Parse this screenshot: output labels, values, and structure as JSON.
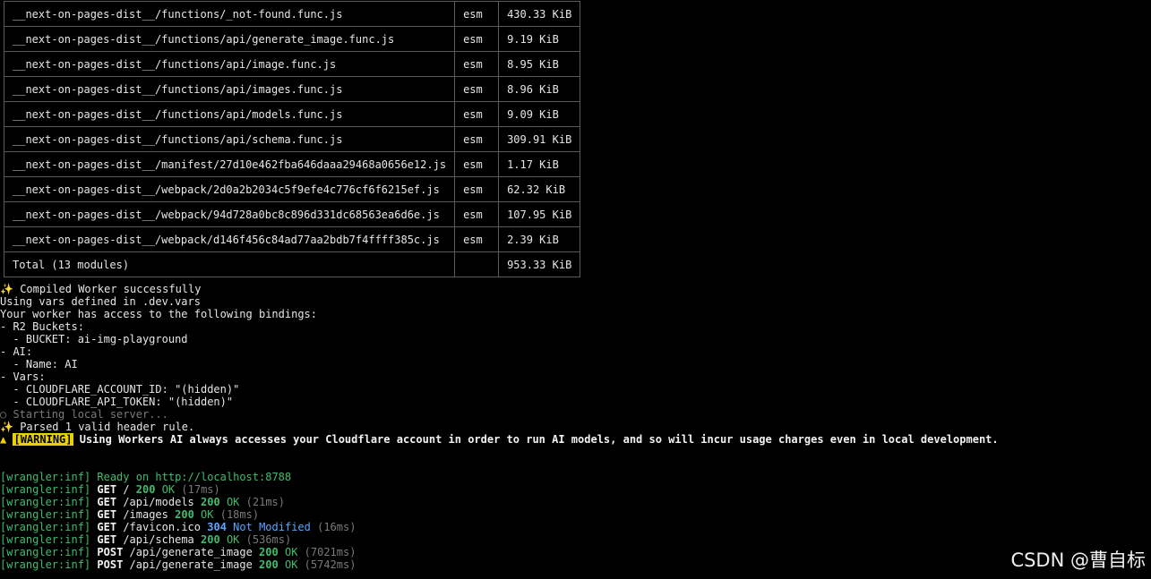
{
  "modules": [
    {
      "name": "__next-on-pages-dist__/functions/_not-found.func.js",
      "format": "esm",
      "size": "430.33 KiB"
    },
    {
      "name": "__next-on-pages-dist__/functions/api/generate_image.func.js",
      "format": "esm",
      "size": "9.19 KiB"
    },
    {
      "name": "__next-on-pages-dist__/functions/api/image.func.js",
      "format": "esm",
      "size": "8.95 KiB"
    },
    {
      "name": "__next-on-pages-dist__/functions/api/images.func.js",
      "format": "esm",
      "size": "8.96 KiB"
    },
    {
      "name": "__next-on-pages-dist__/functions/api/models.func.js",
      "format": "esm",
      "size": "9.09 KiB"
    },
    {
      "name": "__next-on-pages-dist__/functions/api/schema.func.js",
      "format": "esm",
      "size": "309.91 KiB"
    },
    {
      "name": "__next-on-pages-dist__/manifest/27d10e462fba646daaa29468a0656e12.js",
      "format": "esm",
      "size": "1.17 KiB"
    },
    {
      "name": "__next-on-pages-dist__/webpack/2d0a2b2034c5f9efe4c776cf6f6215ef.js",
      "format": "esm",
      "size": "62.32 KiB"
    },
    {
      "name": "__next-on-pages-dist__/webpack/94d728a0bc8c896d331dc68563ea6d6e.js",
      "format": "esm",
      "size": "107.95 KiB"
    },
    {
      "name": "__next-on-pages-dist__/webpack/d146f456c84ad77aa2bdb7f4ffff385c.js",
      "format": "esm",
      "size": "2.39 KiB"
    }
  ],
  "total": {
    "label": "Total (13 modules)",
    "size": "953.33 KiB"
  },
  "log": {
    "compiled": "Compiled Worker successfully",
    "spark_glyph": "✨",
    "vars_file": "Using vars defined in .dev.vars",
    "bindings_header": "Your worker has access to the following bindings:",
    "r2_header": "- R2 Buckets:",
    "r2_item": "  - BUCKET: ai-img-playground",
    "ai_header": "- AI:",
    "ai_item": "  - Name: AI",
    "vars_header": "- Vars:",
    "var_account": "  - CLOUDFLARE_ACCOUNT_ID: \"(hidden)\"",
    "var_token": "  - CLOUDFLARE_API_TOKEN: \"(hidden)\"",
    "starting_glyph": "○",
    "starting": " Starting local server...",
    "parsed": "Parsed 1 valid header rule.",
    "warn_glyph": "▲",
    "warn_badge": "[WARNING]",
    "warn_text": " Using Workers AI always accesses your Cloudflare account in order to run AI models, and so will incur usage charges even in local development.",
    "ready_prefix": "[wrangler:inf]",
    "ready_text": " Ready on http://localhost:8788"
  },
  "requests": [
    {
      "prefix": "[wrangler:inf]",
      "method": "GET",
      "path": "/",
      "code": "200",
      "status": "OK",
      "time": "(17ms)",
      "kind": "ok"
    },
    {
      "prefix": "[wrangler:inf]",
      "method": "GET",
      "path": "/api/models",
      "code": "200",
      "status": "OK",
      "time": "(21ms)",
      "kind": "ok"
    },
    {
      "prefix": "[wrangler:inf]",
      "method": "GET",
      "path": "/images",
      "code": "200",
      "status": "OK",
      "time": "(18ms)",
      "kind": "ok"
    },
    {
      "prefix": "[wrangler:inf]",
      "method": "GET",
      "path": "/favicon.ico",
      "code": "304",
      "status": "Not Modified",
      "time": "(16ms)",
      "kind": "redirect"
    },
    {
      "prefix": "[wrangler:inf]",
      "method": "GET",
      "path": "/api/schema",
      "code": "200",
      "status": "OK",
      "time": "(536ms)",
      "kind": "ok"
    },
    {
      "prefix": "[wrangler:inf]",
      "method": "POST",
      "path": "/api/generate_image",
      "code": "200",
      "status": "OK",
      "time": "(7021ms)",
      "kind": "ok"
    },
    {
      "prefix": "[wrangler:inf]",
      "method": "POST",
      "path": "/api/generate_image",
      "code": "200",
      "status": "OK",
      "time": "(5742ms)",
      "kind": "ok"
    }
  ],
  "watermark": "CSDN @曹自标"
}
